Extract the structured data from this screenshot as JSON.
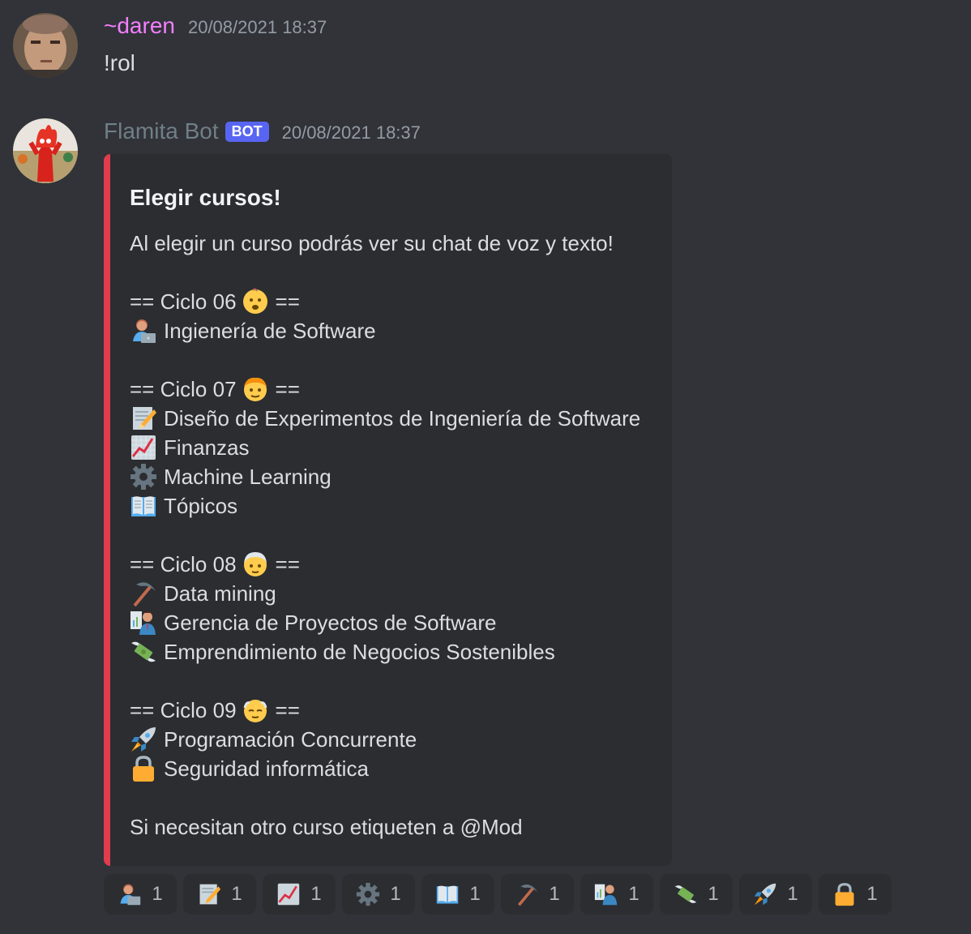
{
  "messages": [
    {
      "username": "~daren",
      "username_color": "#f47fff",
      "timestamp": "20/08/2021 18:37",
      "text": "!rol"
    },
    {
      "username": "Flamita Bot",
      "username_color": "#707f86",
      "bot_tag": "BOT",
      "timestamp": "20/08/2021 18:37"
    }
  ],
  "embed": {
    "accent_color": "#e03c4e",
    "title": "Elegir cursos!",
    "intro": "Al elegir un curso podrás ver su chat de voz y texto!",
    "cycles": [
      {
        "prefix": "== Ciclo 06",
        "suffix": "==",
        "icon": "baby-face-icon",
        "courses": [
          {
            "icon": "technologist-icon",
            "label": "Ingienería de Software"
          }
        ]
      },
      {
        "prefix": "== Ciclo 07",
        "suffix": "==",
        "icon": "child-face-icon",
        "courses": [
          {
            "icon": "memo-icon",
            "label": "Diseño de Experimentos de Ingeniería de Software"
          },
          {
            "icon": "chart-increasing-icon",
            "label": "Finanzas"
          },
          {
            "icon": "gear-icon",
            "label": "Machine Learning"
          },
          {
            "icon": "open-book-icon",
            "label": "Tópicos"
          }
        ]
      },
      {
        "prefix": "== Ciclo 08",
        "suffix": "==",
        "icon": "older-adult-face-icon",
        "courses": [
          {
            "icon": "pick-icon",
            "label": "Data mining"
          },
          {
            "icon": "presenter-icon",
            "label": "Gerencia de Proyectos de Software"
          },
          {
            "icon": "money-wings-icon",
            "label": "Emprendimiento de Negocios Sostenibles"
          }
        ]
      },
      {
        "prefix": "== Ciclo 09",
        "suffix": "==",
        "icon": "old-man-face-icon",
        "courses": [
          {
            "icon": "rocket-icon",
            "label": "Programación Concurrente"
          },
          {
            "icon": "lock-icon",
            "label": "Seguridad informática"
          }
        ]
      }
    ],
    "footer_text": "Si necesitan otro curso etiqueten a @Mod"
  },
  "reactions": [
    {
      "icon": "technologist-icon",
      "count": "1"
    },
    {
      "icon": "memo-icon",
      "count": "1"
    },
    {
      "icon": "chart-increasing-icon",
      "count": "1"
    },
    {
      "icon": "gear-icon",
      "count": "1"
    },
    {
      "icon": "open-book-icon",
      "count": "1"
    },
    {
      "icon": "pick-icon",
      "count": "1"
    },
    {
      "icon": "presenter-icon",
      "count": "1"
    },
    {
      "icon": "money-wings-icon",
      "count": "1"
    },
    {
      "icon": "rocket-icon",
      "count": "1"
    },
    {
      "icon": "lock-icon",
      "count": "1"
    }
  ]
}
